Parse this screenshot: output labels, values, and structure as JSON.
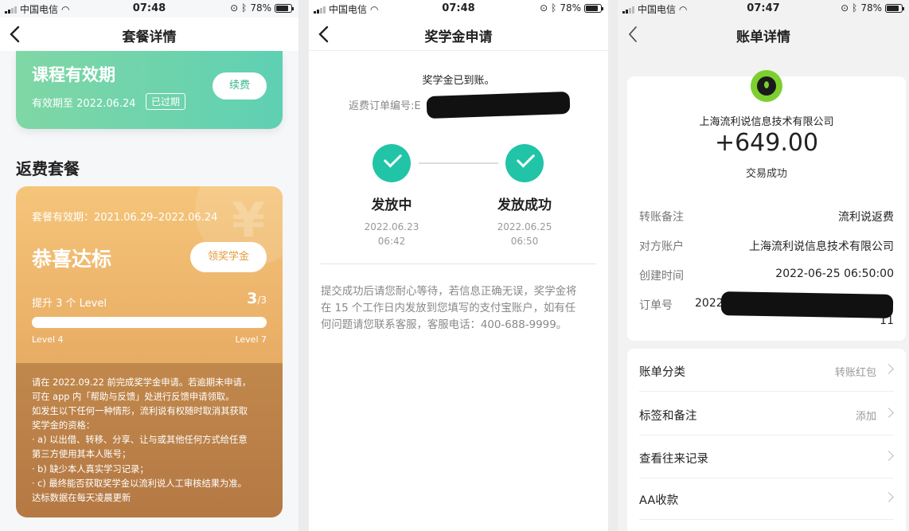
{
  "status": {
    "carrier": "中国电信",
    "battery": "78%"
  },
  "screen1": {
    "time": "07:48",
    "title": "套餐详情",
    "validity": {
      "heading": "课程有效期",
      "until": "有效期至 2022.06.24",
      "tag": "已过期",
      "renew": "续费"
    },
    "section_title": "返费套餐",
    "reward": {
      "yen": "¥",
      "period": "套餐有效期：2021.06.29–2022.06.24",
      "heading": "恭喜达标",
      "claim": "领奖学金",
      "level_text": "提升 3 个 Level",
      "count": "3",
      "count_total": "/3",
      "progress_fraction": 1.0,
      "level_start": "Level 4",
      "level_end": "Level 7",
      "notes": [
        "请在 2022.09.22 前完成奖学金申请。若逾期未申请，",
        "可在 app 内「帮助与反馈」处进行反馈申请领取。",
        "如发生以下任何一种情形，流利说有权随时取消其获取",
        "奖学金的资格：",
        "· a) 以出借、转移、分享、让与或其他任何方式给任意",
        "第三方使用其本人账号；",
        "· b) 缺少本人真实学习记录；",
        "· c) 最终能否获取奖学金以流利说人工审核结果为准。",
        "达标数据在每天凌晨更新"
      ]
    }
  },
  "screen2": {
    "time": "07:48",
    "title": "奖学金申请",
    "arrived": "奖学金已到账。",
    "order_label": "返费订单编号:E",
    "steps": [
      {
        "label": "发放中",
        "date": "2022.06.23",
        "time": "06:42"
      },
      {
        "label": "发放成功",
        "date": "2022.06.25",
        "time": "06:50"
      }
    ],
    "hint": [
      "提交成功后请您耐心等待，若信息正确无误，奖学金将",
      "在 15 个工作日内发放到您填写的支付宝账户，如有任",
      "何问题请您联系客服，客服电话：400-688-9999。"
    ]
  },
  "screen3": {
    "time": "07:47",
    "title": "账单详情",
    "company": "上海流利说信息技术有限公司",
    "amount": "+649.00",
    "tx_status": "交易成功",
    "details": [
      {
        "key": "转账备注",
        "value": "流利说返费"
      },
      {
        "key": "对方账户",
        "value": "上海流利说信息技术有限公司"
      },
      {
        "key": "创建时间",
        "value": "2022-06-25 06:50:00"
      },
      {
        "key": "订单号",
        "value": "2022"
      }
    ],
    "order_tail": "11",
    "list": [
      {
        "key": "账单分类",
        "value": "转账红包"
      },
      {
        "key": "标签和备注",
        "value": "添加"
      },
      {
        "key": "查看往来记录",
        "value": ""
      },
      {
        "key": "AA收款",
        "value": ""
      }
    ]
  }
}
